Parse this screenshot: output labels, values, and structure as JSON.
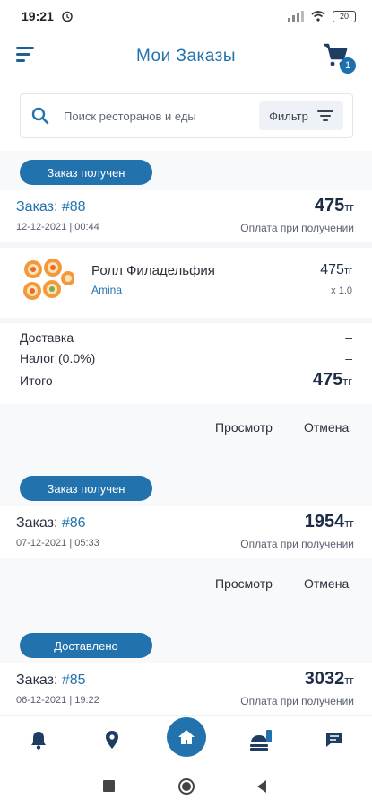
{
  "status": {
    "time": "19:21",
    "battery": "20"
  },
  "header": {
    "title": "Мои Заказы",
    "cart_count": "1"
  },
  "search": {
    "placeholder": "Поиск ресторанов и еды",
    "filter_label": "Фильтр"
  },
  "orders": [
    {
      "status": "Заказ получен",
      "label": "Заказ:",
      "number": "#88",
      "date": "12-12-2021 | 00:44",
      "total": "475",
      "currency": "тг",
      "payment": "Оплата при получении",
      "item": {
        "name": "Ролл Филадельфия",
        "restaurant": "Amina",
        "price": "475",
        "currency": "тг",
        "qty": "x 1.0"
      },
      "summary": {
        "delivery_label": "Доставка",
        "delivery_value": "–",
        "tax_label": "Налог (0.0%)",
        "tax_value": "–",
        "total_label": "Итого",
        "total_value": "475",
        "currency": "тг"
      },
      "view": "Просмотр",
      "cancel": "Отмена"
    },
    {
      "status": "Заказ получен",
      "label": "Заказ:",
      "number": "#86",
      "date": "07-12-2021 | 05:33",
      "total": "1954",
      "currency": "тг",
      "payment": "Оплата при получении",
      "view": "Просмотр",
      "cancel": "Отмена"
    },
    {
      "status": "Доставлено",
      "label": "Заказ:",
      "number": "#85",
      "date": "06-12-2021 | 19:22",
      "total": "3032",
      "currency": "тг",
      "payment": "Оплата при получении"
    }
  ],
  "colors": {
    "accent": "#2272ad",
    "dark": "#1d2b45",
    "bg": "#f8f9fb"
  },
  "nav": {
    "icons": [
      "bell-icon",
      "location-icon",
      "home-icon",
      "food-icon",
      "chat-icon"
    ]
  }
}
